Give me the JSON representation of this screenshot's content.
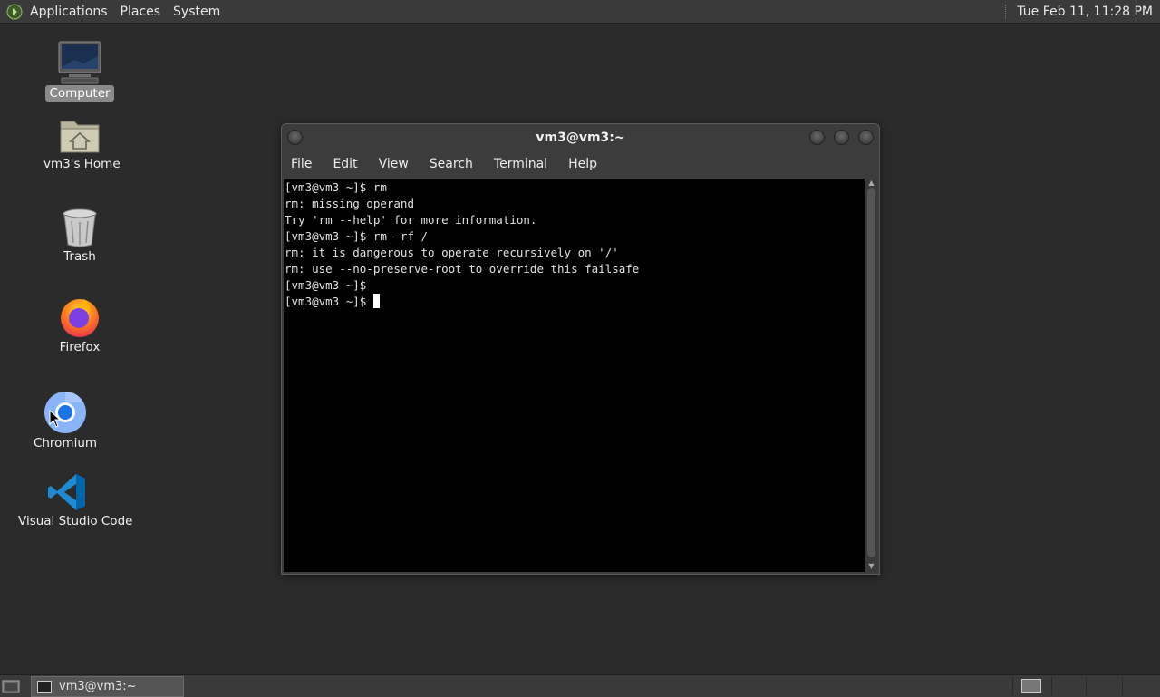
{
  "top_panel": {
    "menus": [
      "Applications",
      "Places",
      "System"
    ],
    "clock": "Tue Feb 11, 11:28 PM"
  },
  "desktop": {
    "icons": [
      {
        "label": "Computer",
        "icon": "computer-icon",
        "selected": true
      },
      {
        "label": "vm3's Home",
        "icon": "home-folder-icon"
      },
      {
        "label": "Trash",
        "icon": "trash-icon"
      },
      {
        "label": "Firefox",
        "icon": "firefox-icon"
      },
      {
        "label": "Chromium",
        "icon": "chromium-icon"
      },
      {
        "label": "Visual Studio Code",
        "icon": "vscode-icon"
      }
    ]
  },
  "window": {
    "title": "vm3@vm3:~",
    "menu": [
      "File",
      "Edit",
      "View",
      "Search",
      "Terminal",
      "Help"
    ],
    "terminal_lines": [
      "[vm3@vm3 ~]$ rm",
      "rm: missing operand",
      "Try 'rm --help' for more information.",
      "[vm3@vm3 ~]$ rm -rf /",
      "rm: it is dangerous to operate recursively on '/'",
      "rm: use --no-preserve-root to override this failsafe",
      "[vm3@vm3 ~]$",
      "[vm3@vm3 ~]$ "
    ]
  },
  "taskbar": {
    "task_label": "vm3@vm3:~"
  },
  "colors": {
    "desktop_bg": "#2b2b2b",
    "panel_bg": "#3a3a3a",
    "terminal_bg": "#000000",
    "terminal_fg": "#e0e0e0"
  }
}
